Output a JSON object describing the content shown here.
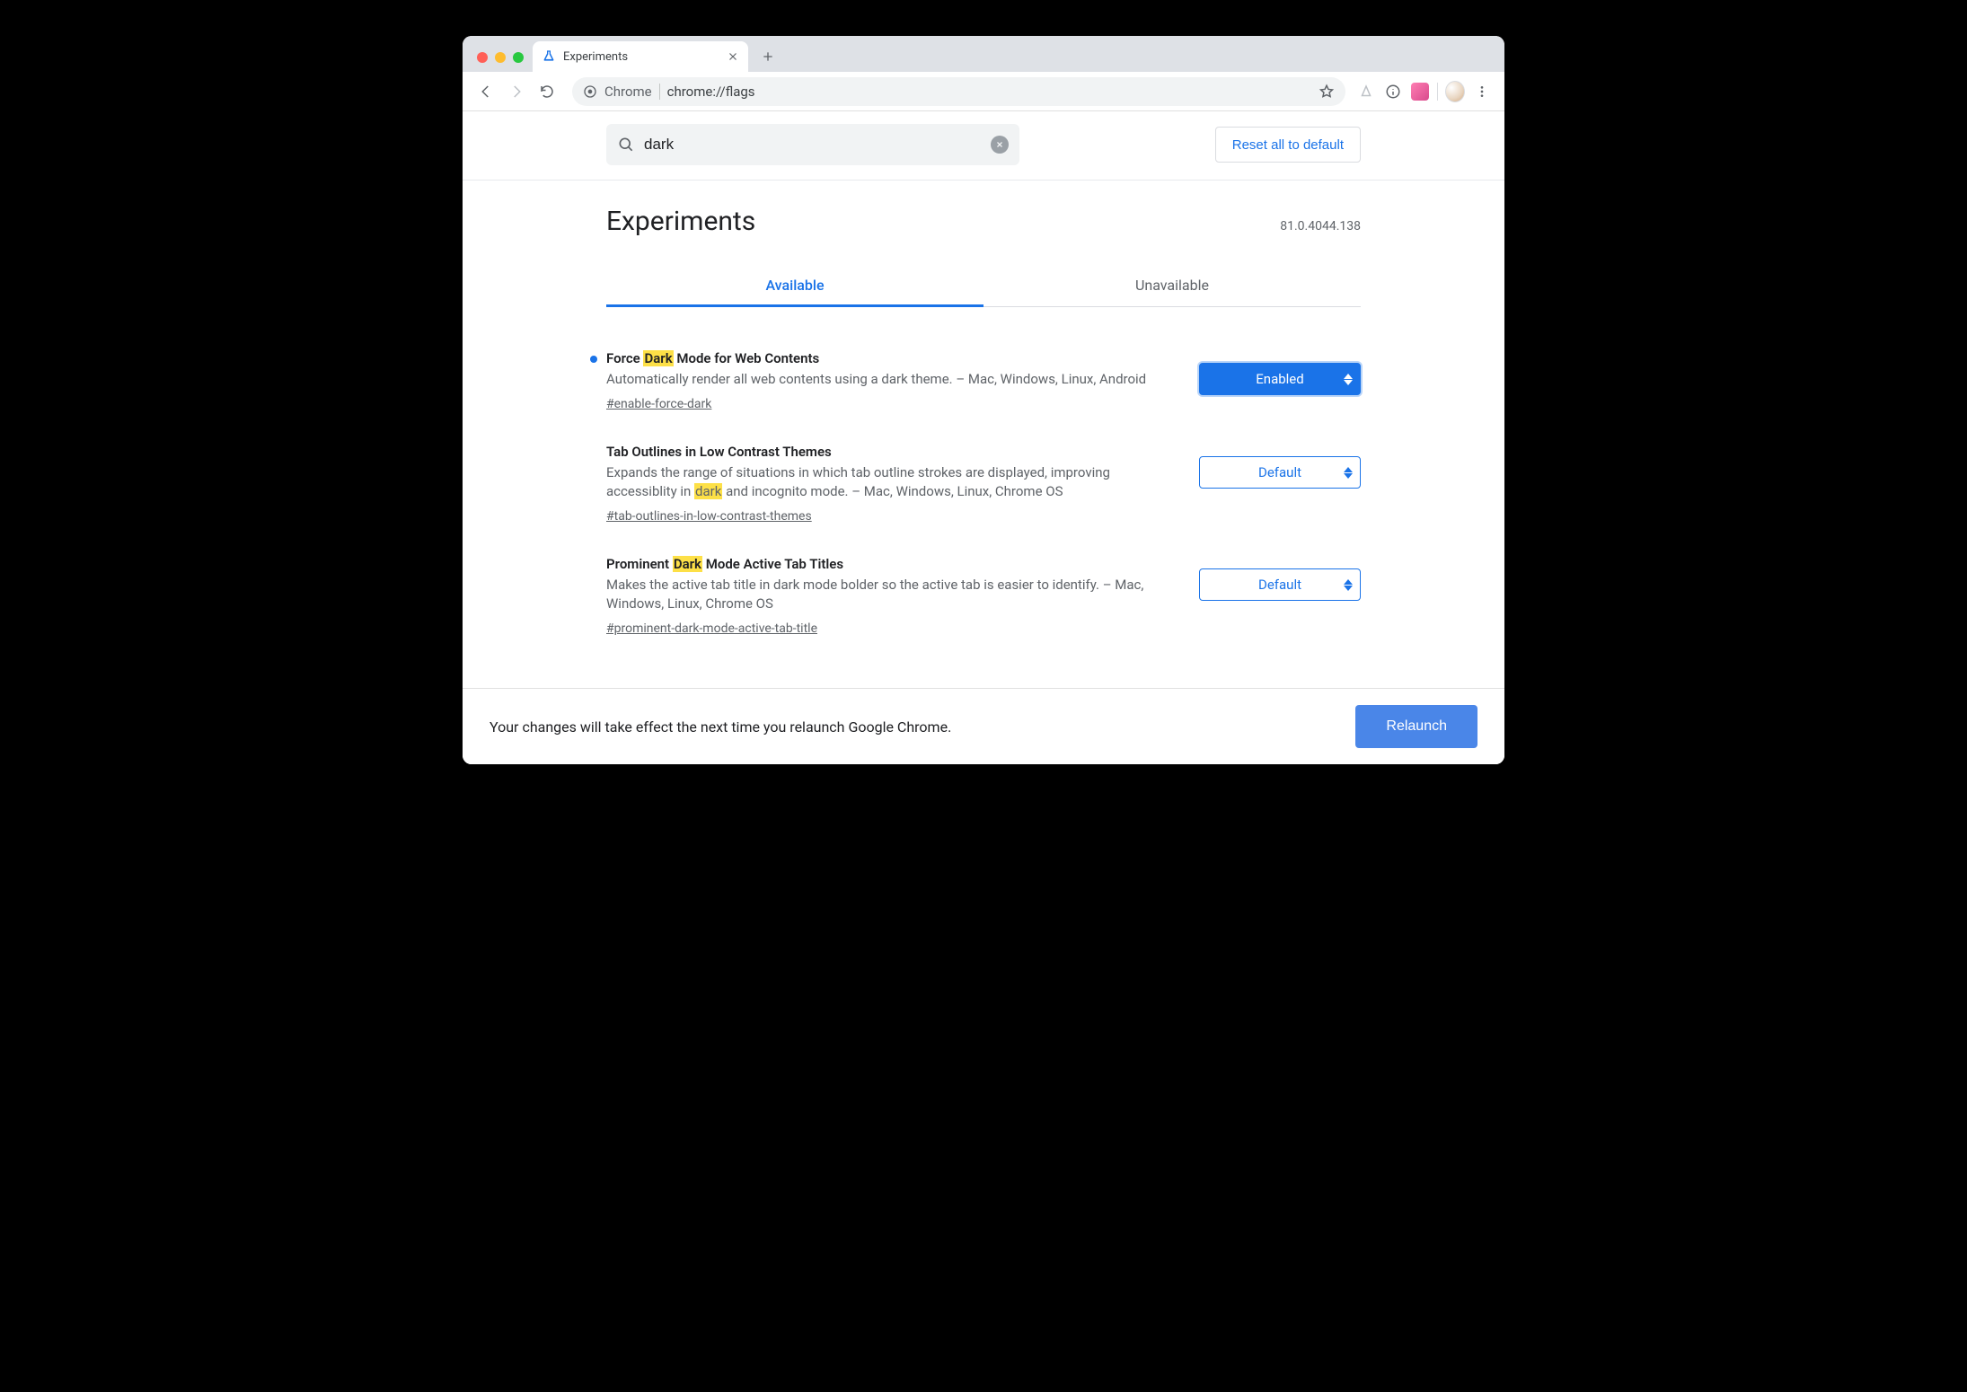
{
  "browser": {
    "tab_title": "Experiments",
    "omnibox_chip": "Chrome",
    "omnibox_url": "chrome://flags"
  },
  "search": {
    "value": "dark",
    "reset_label": "Reset all to default"
  },
  "header": {
    "title": "Experiments",
    "version": "81.0.4044.138"
  },
  "tabs": {
    "available": "Available",
    "unavailable": "Unavailable"
  },
  "flags": [
    {
      "modified": true,
      "title_pre": "Force ",
      "title_hl": "Dark",
      "title_post": " Mode for Web Contents",
      "desc_pre": "Automatically render all web contents using a dark theme. – Mac, Windows, Linux, Android",
      "desc_hl": "",
      "desc_post": "",
      "anchor": "#enable-force-dark",
      "select_value": "Enabled",
      "select_style": "enabled"
    },
    {
      "modified": false,
      "title_pre": "Tab Outlines in Low Contrast Themes",
      "title_hl": "",
      "title_post": "",
      "desc_pre": "Expands the range of situations in which tab outline strokes are displayed, improving accessiblity in ",
      "desc_hl": "dark",
      "desc_post": " and incognito mode. – Mac, Windows, Linux, Chrome OS",
      "anchor": "#tab-outlines-in-low-contrast-themes",
      "select_value": "Default",
      "select_style": "default"
    },
    {
      "modified": false,
      "title_pre": "Prominent ",
      "title_hl": "Dark",
      "title_post": " Mode Active Tab Titles",
      "desc_pre": "Makes the active tab title in dark mode bolder so the active tab is easier to identify. – Mac, Windows, Linux, Chrome OS",
      "desc_hl": "",
      "desc_post": "",
      "anchor": "#prominent-dark-mode-active-tab-title",
      "select_value": "Default",
      "select_style": "default"
    }
  ],
  "relaunch": {
    "message": "Your changes will take effect the next time you relaunch Google Chrome.",
    "button": "Relaunch"
  }
}
